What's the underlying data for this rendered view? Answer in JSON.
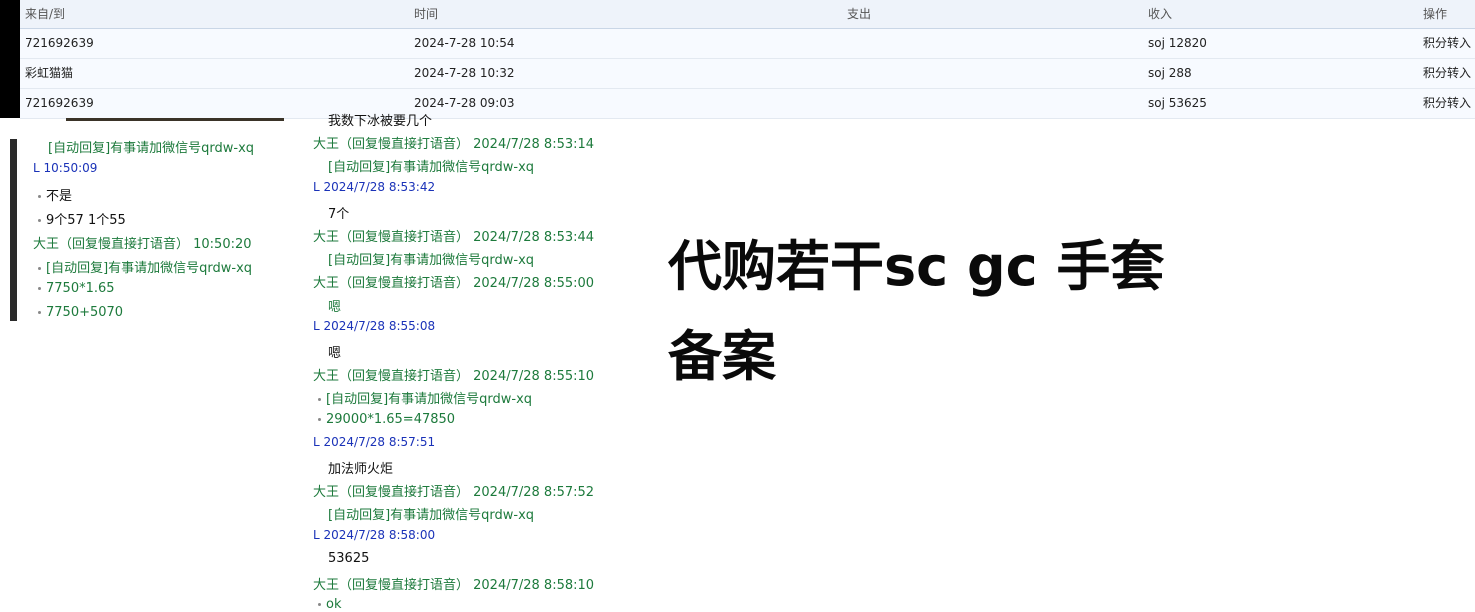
{
  "table": {
    "headers": {
      "from": "来自/到",
      "time": "时间",
      "out": "支出",
      "in": "收入",
      "op": "操作"
    },
    "rows": [
      {
        "from": "721692639",
        "time": "2024-7-28 10:54",
        "out": "",
        "in": "soj 12820",
        "op": "积分转入"
      },
      {
        "from": "彩虹猫猫",
        "time": "2024-7-28 10:32",
        "out": "",
        "in": "soj 288",
        "op": "积分转入"
      },
      {
        "from": "721692639",
        "time": "2024-7-28 09:03",
        "out": "",
        "in": "soj 53625",
        "op": "积分转入"
      }
    ]
  },
  "left_chat": [
    {
      "text": "[自动回复]有事请加微信号qrdw-xq",
      "style": "green",
      "bullet": false
    },
    {
      "text": "L  10:50:09",
      "style": "blue",
      "bullet": false
    },
    {
      "text": "不是",
      "style": "black",
      "bullet": true
    },
    {
      "text": "9个57 1个55",
      "style": "black",
      "bullet": true
    },
    {
      "text": "大王（回复慢直接打语音）   10:50:20",
      "style": "green",
      "bullet": false
    },
    {
      "text": "[自动回复]有事请加微信号qrdw-xq",
      "style": "green",
      "bullet": true
    },
    {
      "text": "7750*1.65",
      "style": "green",
      "bullet": true
    },
    {
      "text": "7750+5070",
      "style": "green",
      "bullet": true
    }
  ],
  "mid_chat": [
    {
      "text": "我数下冰被要几个",
      "style": "black",
      "bullet": false
    },
    {
      "text": "大王（回复慢直接打语音）  2024/7/28 8:53:14",
      "style": "green",
      "bullet": false
    },
    {
      "text": "[自动回复]有事请加微信号qrdw-xq",
      "style": "green",
      "bullet": false
    },
    {
      "text": "L 2024/7/28 8:53:42",
      "style": "blue",
      "bullet": false
    },
    {
      "text": "7个",
      "style": "black",
      "bullet": false
    },
    {
      "text": "大王（回复慢直接打语音）  2024/7/28 8:53:44",
      "style": "green",
      "bullet": false
    },
    {
      "text": "[自动回复]有事请加微信号qrdw-xq",
      "style": "green",
      "bullet": false
    },
    {
      "text": "大王（回复慢直接打语音）  2024/7/28 8:55:00",
      "style": "green",
      "bullet": false
    },
    {
      "text": "嗯",
      "style": "green",
      "bullet": false
    },
    {
      "text": "L 2024/7/28 8:55:08",
      "style": "blue",
      "bullet": false
    },
    {
      "text": "嗯",
      "style": "black",
      "bullet": false
    },
    {
      "text": "大王（回复慢直接打语音）  2024/7/28 8:55:10",
      "style": "green",
      "bullet": false
    },
    {
      "text": "[自动回复]有事请加微信号qrdw-xq",
      "style": "green",
      "bullet": true
    },
    {
      "text": "29000*1.65=47850",
      "style": "green",
      "bullet": true
    },
    {
      "text": "L 2024/7/28 8:57:51",
      "style": "blue",
      "bullet": false
    },
    {
      "text": "加法师火炬",
      "style": "black",
      "bullet": false
    },
    {
      "text": "大王（回复慢直接打语音）  2024/7/28 8:57:52",
      "style": "green",
      "bullet": false
    },
    {
      "text": "[自动回复]有事请加微信号qrdw-xq",
      "style": "green",
      "bullet": false
    },
    {
      "text": "L 2024/7/28 8:58:00",
      "style": "blue",
      "bullet": false
    },
    {
      "text": "53625",
      "style": "black",
      "bullet": false
    },
    {
      "text": "大王（回复慢直接打语音）  2024/7/28 8:58:10",
      "style": "green",
      "bullet": false
    },
    {
      "text": "ok",
      "style": "green",
      "bullet": true
    }
  ],
  "headline": {
    "line1": "代购若干sc gc 手套",
    "line2": "备案"
  }
}
